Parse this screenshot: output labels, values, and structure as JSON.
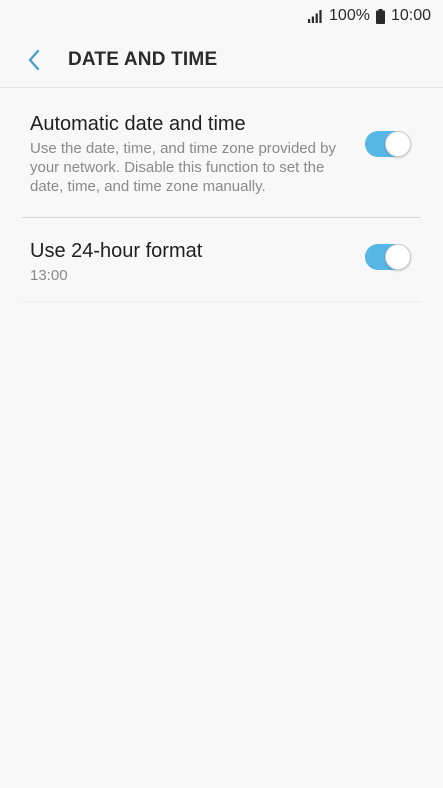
{
  "status_bar": {
    "battery": "100%",
    "time": "10:00",
    "signal_icon": "signal-icon",
    "battery_icon": "battery-icon"
  },
  "header": {
    "title": "DATE AND TIME",
    "back_icon": "chevron-left-icon",
    "accent_color": "#4a9fc6"
  },
  "settings": [
    {
      "title": "Automatic date and time",
      "summary": "Use the date, time, and time zone provided by your network. Disable this function to set the date, time, and time zone manually.",
      "enabled": true
    },
    {
      "title": "Use 24-hour format",
      "summary": "13:00",
      "enabled": true
    }
  ],
  "colors": {
    "toggle_on": "#56b7e6",
    "background": "#f8f8f8"
  }
}
